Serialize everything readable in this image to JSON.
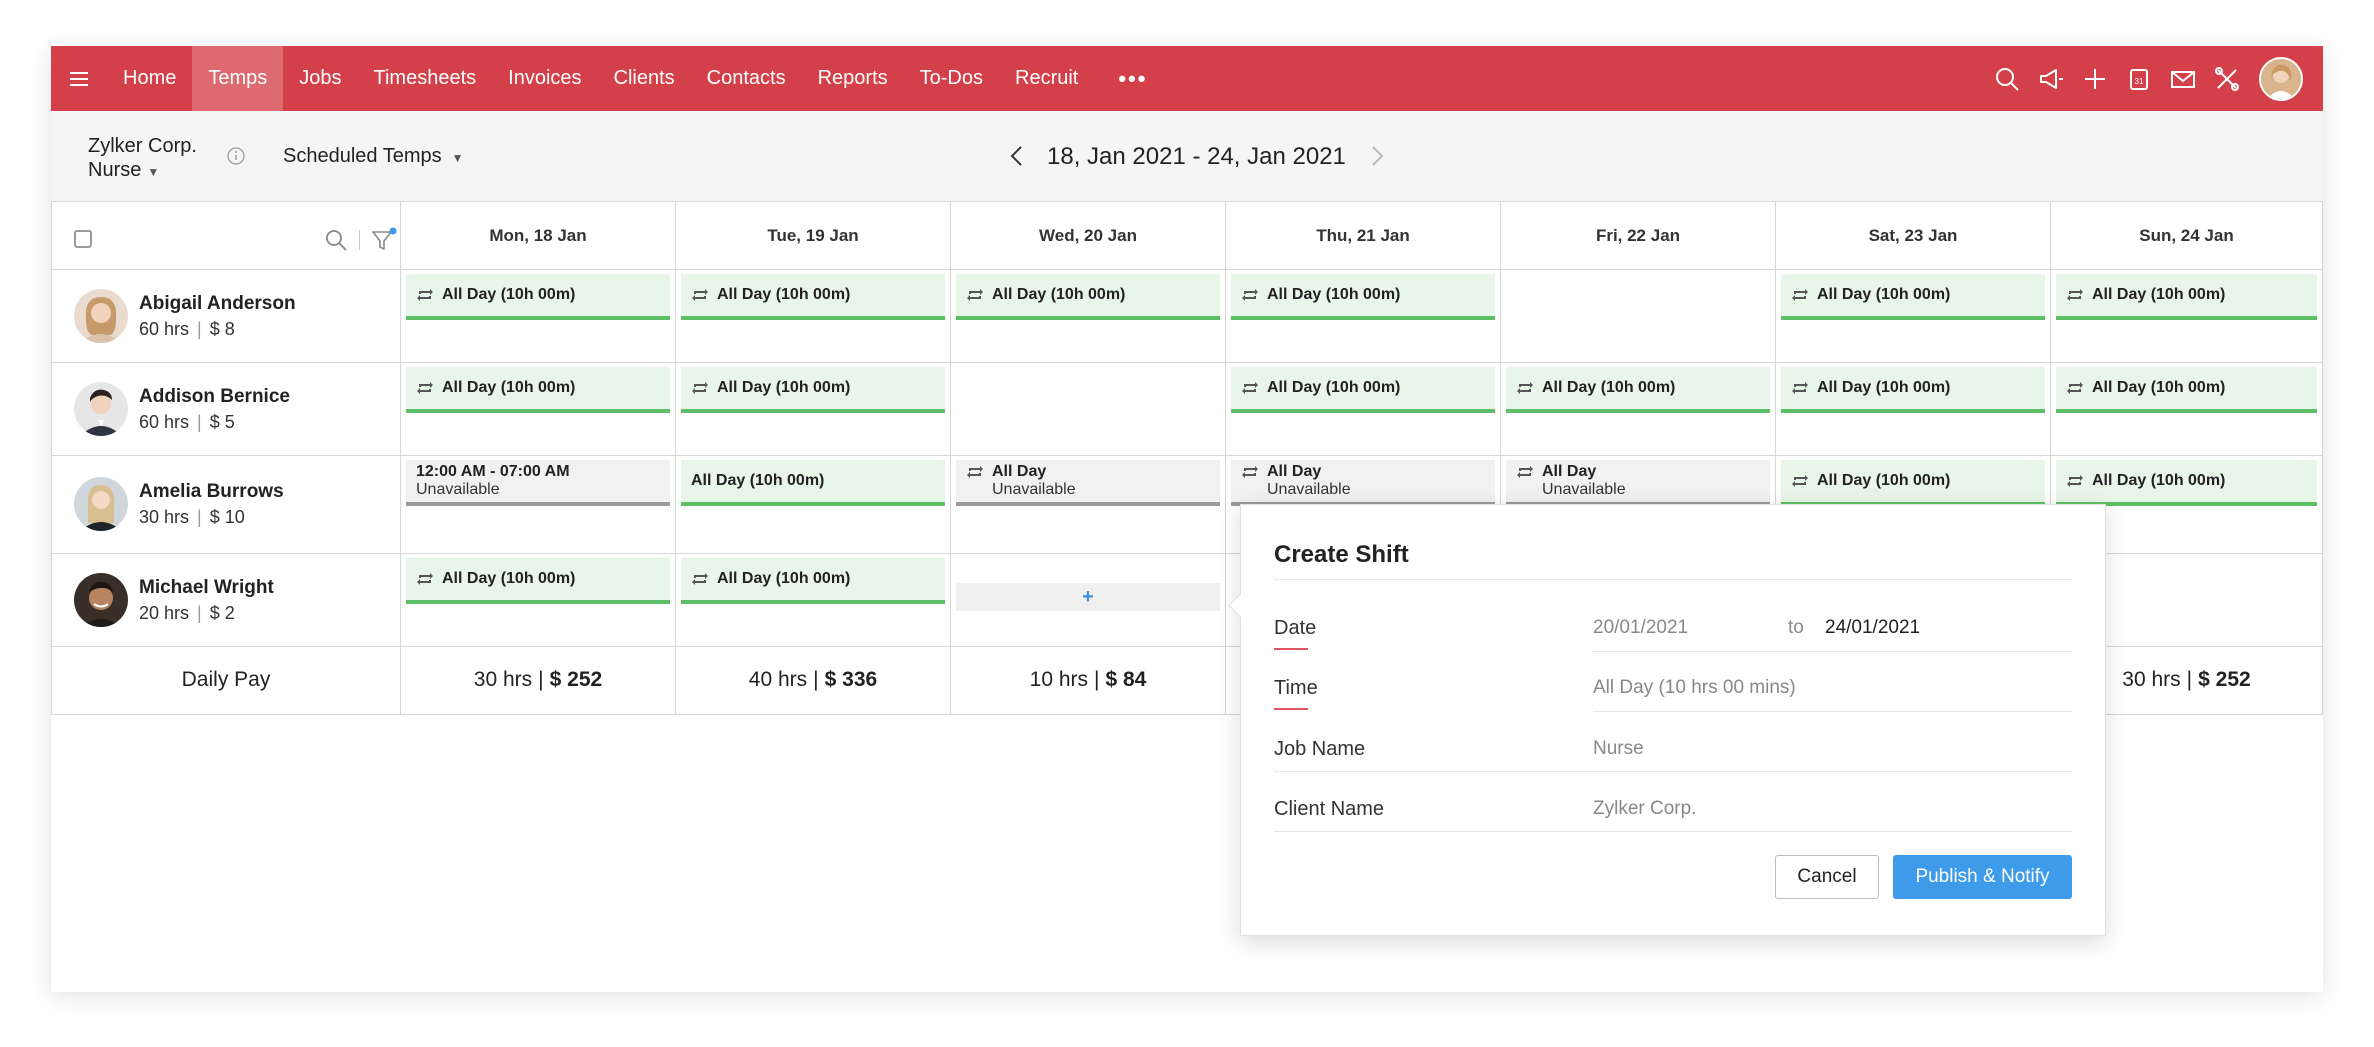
{
  "nav": {
    "items": [
      "Home",
      "Temps",
      "Jobs",
      "Timesheets",
      "Invoices",
      "Clients",
      "Contacts",
      "Reports",
      "To-Dos",
      "Recruit"
    ],
    "active": "Temps",
    "more": "•••",
    "icons": [
      "search-icon",
      "megaphone-icon",
      "plus-icon",
      "calendar-icon",
      "mail-icon",
      "tools-icon"
    ],
    "brand_color": "#d4404a"
  },
  "subheader": {
    "client": "Zylker Corp.",
    "job": "Nurse",
    "view": "Scheduled Temps",
    "date_range": "18, Jan 2021 - 24, Jan 2021"
  },
  "days": [
    "Mon, 18 Jan",
    "Tue, 19 Jan",
    "Wed, 20 Jan",
    "Thu, 21 Jan",
    "Fri, 22 Jan",
    "Sat, 23 Jan",
    "Sun, 24 Jan"
  ],
  "temps": [
    {
      "name": "Abigail Anderson",
      "hours": "60 hrs",
      "rate": "$ 8",
      "shifts": [
        {
          "type": "shift",
          "label": "All Day (10h 00m)"
        },
        {
          "type": "shift",
          "label": "All Day (10h 00m)"
        },
        {
          "type": "shift",
          "label": "All Day (10h 00m)"
        },
        {
          "type": "shift",
          "label": "All Day (10h 00m)"
        },
        {
          "type": "empty"
        },
        {
          "type": "shift",
          "label": "All Day (10h 00m)"
        },
        {
          "type": "shift",
          "label": "All Day (10h 00m)"
        }
      ]
    },
    {
      "name": "Addison Bernice",
      "hours": "60 hrs",
      "rate": "$ 5",
      "shifts": [
        {
          "type": "shift",
          "label": "All Day (10h 00m)"
        },
        {
          "type": "shift",
          "label": "All Day (10h 00m)"
        },
        {
          "type": "empty"
        },
        {
          "type": "shift",
          "label": "All Day (10h 00m)"
        },
        {
          "type": "shift",
          "label": "All Day (10h 00m)"
        },
        {
          "type": "shift",
          "label": "All Day (10h 00m)"
        },
        {
          "type": "shift",
          "label": "All Day (10h 00m)"
        }
      ]
    },
    {
      "name": "Amelia Burrows",
      "hours": "30 hrs",
      "rate": "$ 10",
      "shifts": [
        {
          "type": "unavail",
          "label": "12:00 AM - 07:00 AM",
          "sub": "Unavailable",
          "icon": false
        },
        {
          "type": "shift",
          "label": "All Day (10h 00m)",
          "icon": false
        },
        {
          "type": "unavail",
          "label": "All Day",
          "sub": "Unavailable",
          "icon": true
        },
        {
          "type": "unavail",
          "label": "All Day",
          "sub": "Unavailable",
          "icon": true
        },
        {
          "type": "unavail",
          "label": "All Day",
          "sub": "Unavailable",
          "icon": true
        },
        {
          "type": "shift",
          "label": "All Day (10h 00m)"
        },
        {
          "type": "shift",
          "label": "All Day (10h 00m)"
        }
      ]
    },
    {
      "name": "Michael Wright",
      "hours": "20 hrs",
      "rate": "$ 2",
      "shifts": [
        {
          "type": "shift",
          "label": "All Day (10h 00m)"
        },
        {
          "type": "shift",
          "label": "All Day (10h 00m)"
        },
        {
          "type": "add",
          "label": "+"
        },
        {
          "type": "empty"
        },
        {
          "type": "empty"
        },
        {
          "type": "empty"
        },
        {
          "type": "empty"
        }
      ]
    }
  ],
  "daily_pay": {
    "label": "Daily Pay",
    "cells": [
      {
        "hrs": "30 hrs",
        "amt": "$ 252"
      },
      {
        "hrs": "40 hrs",
        "amt": "$ 336"
      },
      {
        "hrs": "10 hrs",
        "amt": "$ 84"
      },
      null,
      null,
      null,
      {
        "hrs": "30 hrs",
        "amt": "$ 252"
      }
    ]
  },
  "popup": {
    "title": "Create Shift",
    "date_label": "Date",
    "date_from": "20/01/2021",
    "date_to_word": "to",
    "date_to": "24/01/2021",
    "time_label": "Time",
    "time_value": "All Day (10 hrs 00 mins)",
    "job_label": "Job Name",
    "job_value": "Nurse",
    "client_label": "Client Name",
    "client_value": "Zylker Corp.",
    "cancel": "Cancel",
    "publish": "Publish & Notify",
    "publish_color": "#3d9be9"
  }
}
